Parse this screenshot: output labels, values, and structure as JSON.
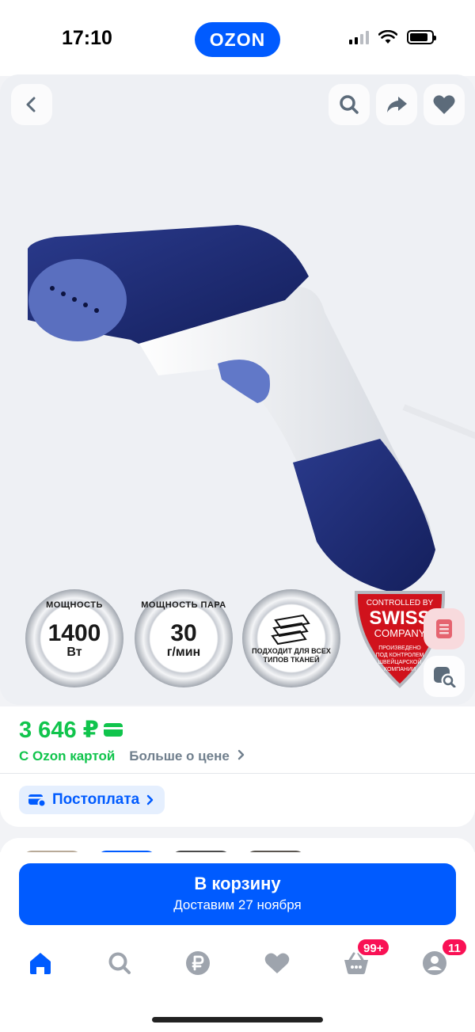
{
  "status_bar": {
    "time": "17:10",
    "logo": "OZON"
  },
  "gallery": {
    "actions": {
      "back_icon": "chevron-left-icon",
      "search_icon": "search-icon",
      "share_icon": "share-icon",
      "favorite_icon": "heart-icon"
    },
    "badges": [
      {
        "top": "МОЩНОСТЬ",
        "big": "1400",
        "small": "Вт"
      },
      {
        "top": "МОЩНОСТЬ ПАРА",
        "big": "30",
        "small": "г/мин"
      },
      {
        "text": "ПОДХОДИТ ДЛЯ ВСЕХ ТИПОВ ТКАНЕЙ"
      }
    ],
    "swiss_badge": {
      "line1": "CONTROLLED BY",
      "line2": "SWISS",
      "line3": "COMPANY",
      "line4": "ПРОИЗВЕДЕНО",
      "line5": "ПОД КОНТРОЛЕМ",
      "line6": "ШВЕЙЦАРСКОЙ",
      "line7": "КОМПАНИИ"
    }
  },
  "price": {
    "value": "3 646 ₽",
    "ozon_card_label": "С Ozon картой",
    "more_label": "Больше о цене",
    "postpay_label": "Постоплата"
  },
  "cart": {
    "button_label": "В корзину",
    "delivery_label": "Доставим 27 ноября"
  },
  "tabbar": {
    "items": [
      {
        "name": "home",
        "icon": "home-icon"
      },
      {
        "name": "search",
        "icon": "search-icon"
      },
      {
        "name": "finance",
        "icon": "ruble-icon"
      },
      {
        "name": "favorites",
        "icon": "heart-icon"
      },
      {
        "name": "cart",
        "icon": "basket-icon",
        "badge": "99+"
      },
      {
        "name": "profile",
        "icon": "profile-icon",
        "badge": "11"
      }
    ]
  },
  "colors": {
    "brand_blue": "#005bff",
    "price_green": "#10c44c",
    "badge_pink": "#f91155"
  }
}
